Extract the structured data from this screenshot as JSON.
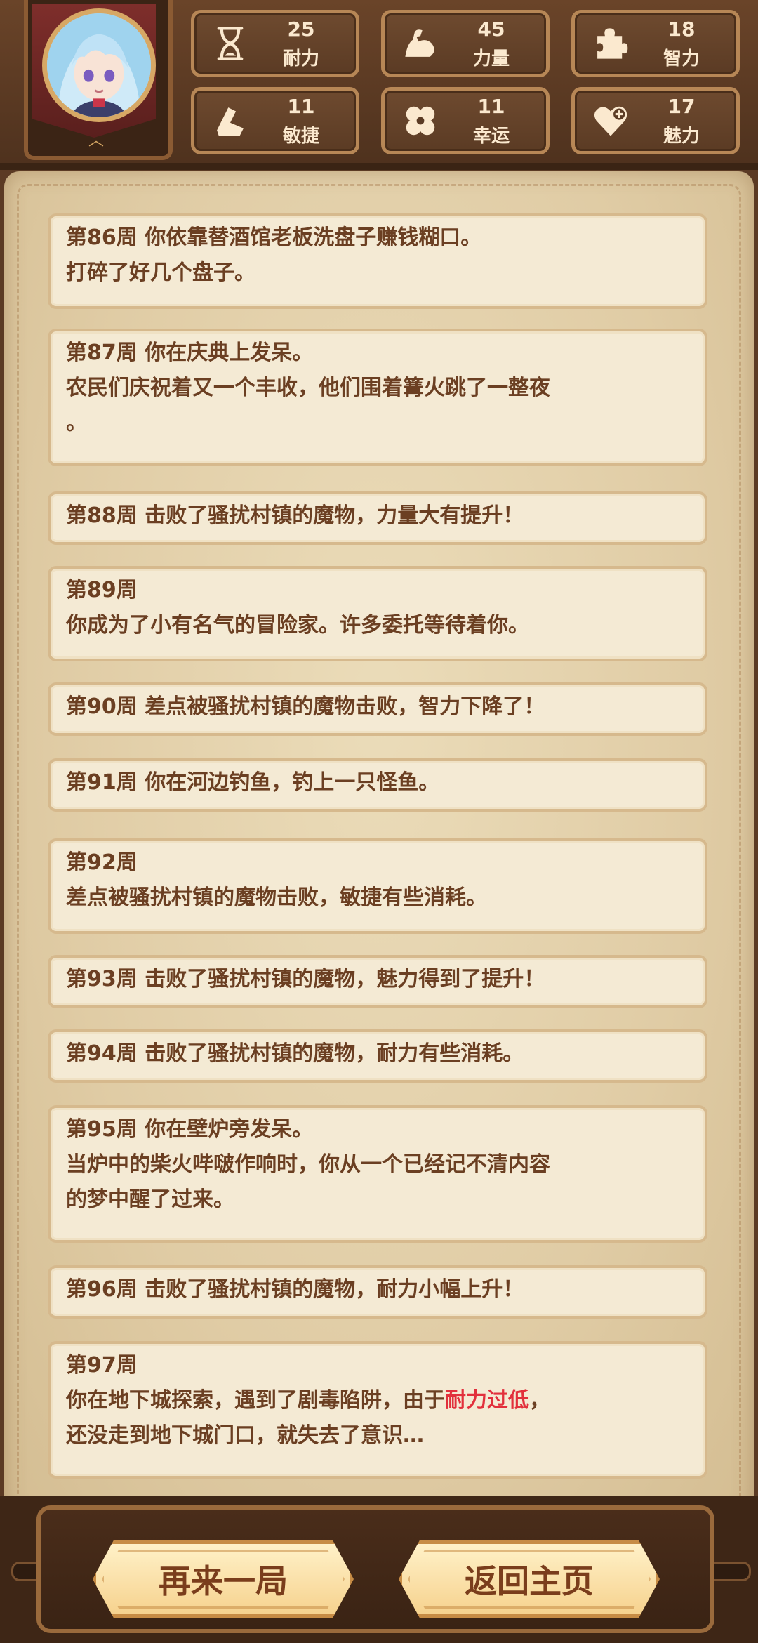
{
  "stats": [
    {
      "value": "25",
      "label": "耐力",
      "icon": "hourglass-icon"
    },
    {
      "value": "45",
      "label": "力量",
      "icon": "bicep-icon"
    },
    {
      "value": "18",
      "label": "智力",
      "icon": "puzzle-icon"
    },
    {
      "value": "11",
      "label": "敏捷",
      "icon": "boot-icon"
    },
    {
      "value": "11",
      "label": "幸运",
      "icon": "clover-icon"
    },
    {
      "value": "17",
      "label": "魅力",
      "icon": "heart-plus-icon"
    }
  ],
  "log": [
    {
      "lines": [
        "第86周 你依靠替酒馆老板洗盘子赚钱糊口。",
        "打碎了好几个盘子。"
      ]
    },
    {
      "lines": [
        "第87周 你在庆典上发呆。",
        "农民们庆祝着又一个丰收，他们围着篝火跳了一整夜",
        "。"
      ]
    },
    {
      "lines": [
        "第88周 击败了骚扰村镇的魔物，力量大有提升！"
      ]
    },
    {
      "lines": [
        "第89周",
        "你成为了小有名气的冒险家。许多委托等待着你。"
      ]
    },
    {
      "lines": [
        "第90周 差点被骚扰村镇的魔物击败，智力下降了！"
      ]
    },
    {
      "lines": [
        "第91周 你在河边钓鱼，钓上一只怪鱼。"
      ]
    },
    {
      "lines": [
        "第92周",
        "差点被骚扰村镇的魔物击败，敏捷有些消耗。"
      ]
    },
    {
      "lines": [
        "第93周 击败了骚扰村镇的魔物，魅力得到了提升！"
      ]
    },
    {
      "lines": [
        "第94周 击败了骚扰村镇的魔物，耐力有些消耗。"
      ]
    },
    {
      "lines": [
        "第95周 你在壁炉旁发呆。",
        "当炉中的柴火哔啵作响时，你从一个已经记不清内容",
        "的梦中醒了过来。"
      ]
    },
    {
      "lines": [
        "第96周 击败了骚扰村镇的魔物，耐力小幅上升！"
      ]
    },
    {
      "lines": [
        "第97周"
      ],
      "line2_before": "你在地下城探索，遇到了剧毒陷阱，由于",
      "line2_highlight": "耐力过低",
      "line2_after": "，",
      "line3": "还没走到地下城门口，就失去了意识…"
    }
  ],
  "highlight_color": "#e2303c",
  "buttons": {
    "restart": "再来一局",
    "home": "返回主页"
  }
}
